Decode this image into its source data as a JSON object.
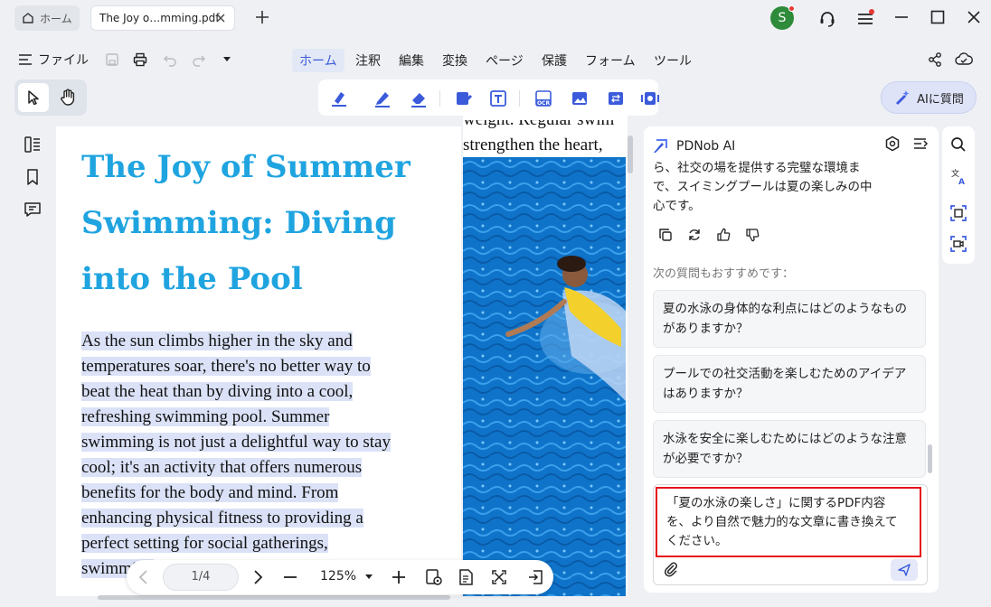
{
  "tabs": {
    "home_label": "ホーム",
    "doc_label": "The Joy o…mming.pdf"
  },
  "user": {
    "avatar_initial": "S"
  },
  "menu": {
    "file_label": "ファイル",
    "items": [
      "ホーム",
      "注釈",
      "編集",
      "変換",
      "ページ",
      "保護",
      "フォーム",
      "ツール"
    ],
    "active_index": 0
  },
  "toolbar": {
    "ai_ask_label": "AIに質問"
  },
  "document": {
    "title": "The Joy of Summer Swimming: Diving into the Pool",
    "body_lines": [
      "As the sun climbs higher in the sky and",
      "temperatures soar, there's no better way to",
      "beat the heat than by diving into a cool,",
      "refreshing swimming pool. Summer",
      "swimming is not just a delightful way to stay",
      "cool; it's an activity that offers numerous",
      "benefits for the body and mind. From",
      "enhancing physical fitness to providing a",
      "perfect setting for social gatherings,",
      "swimming"
    ],
    "right_col_line1": "weight. Regular swim",
    "right_col_line2": "strengthen the heart,"
  },
  "page_nav": {
    "page": "1/4",
    "zoom": "125%"
  },
  "ai_panel": {
    "title": "PDNob AI",
    "answer_lines": [
      "ら、社交の場を提供する完璧な環境ま",
      "で、スイミングプールは夏の楽しみの中",
      "心です。"
    ],
    "suggest_label": "次の質問もおすすめです：",
    "suggestions": [
      [
        "夏の水泳の身体的な利点にはどのようなもの",
        "がありますか？"
      ],
      [
        "プールでの社交活動を楽しむためのアイデア",
        "はありますか？"
      ],
      [
        "水泳を安全に楽しむためにはどのような注意",
        "が必要ですか？"
      ]
    ],
    "input_lines": [
      "「夏の水泳の楽しさ」に関するPDF内容",
      "を、より自然で魅力的な文章に書き換えて",
      "ください。"
    ]
  },
  "colors": {
    "accent": "#3b5bdb",
    "title_blue": "#1fa4e0",
    "highlight": "#dbe2f7",
    "focus_border": "#e5121b"
  }
}
